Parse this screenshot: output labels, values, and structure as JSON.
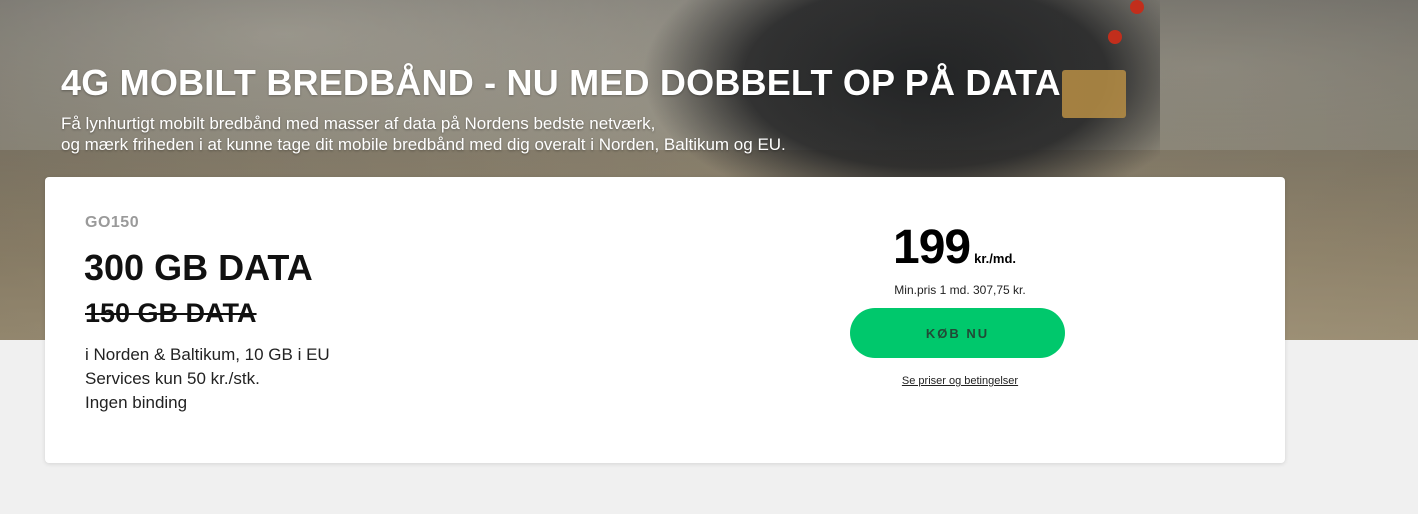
{
  "hero": {
    "title": "4G MOBILT BREDBÅND - NU MED DOBBELT OP PÅ DATA",
    "subtitle_line1": "Få lynhurtigt mobilt bredbånd med masser af data på Nordens bedste netværk,",
    "subtitle_line2": "og mærk friheden i at kunne tage dit mobile bredbånd med dig overalt i Norden, Baltikum og EU."
  },
  "plan": {
    "code": "GO150",
    "data": "300 GB DATA",
    "old_data": "150 GB DATA",
    "features": [
      "i Norden & Baltikum, 10 GB i EU",
      "Services kun 50 kr./stk.",
      "Ingen binding"
    ],
    "price": "199",
    "price_unit": "kr./md.",
    "min_price": "Min.pris 1 md. 307,75 kr.",
    "buy_label": "KØB NU",
    "terms_label": "Se priser og betingelser"
  },
  "colors": {
    "accent": "#00c86c",
    "background": "#f0f0f0",
    "card": "#ffffff"
  }
}
